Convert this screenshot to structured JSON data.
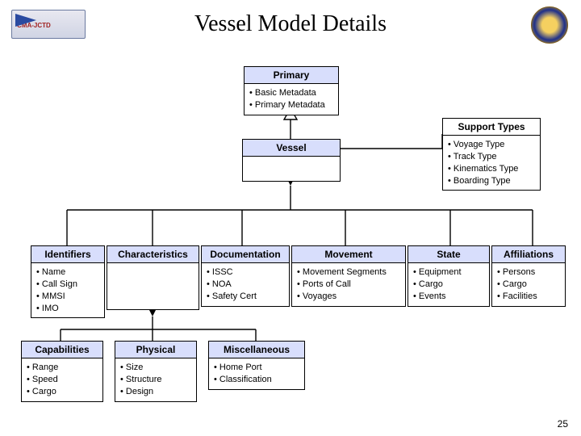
{
  "title": "Vessel Model Details",
  "page_number": "25",
  "primary": {
    "title": "Primary",
    "items": [
      "Basic Metadata",
      "Primary Metadata"
    ]
  },
  "vessel": {
    "title": "Vessel"
  },
  "support": {
    "title": "Support Types",
    "items": [
      "Voyage Type",
      "Track Type",
      "Kinematics Type",
      "Boarding Type"
    ]
  },
  "row1": [
    {
      "title": "Identifiers",
      "items": [
        "Name",
        "Call Sign",
        "MMSI",
        "IMO"
      ]
    },
    {
      "title": "Characteristics",
      "items": []
    },
    {
      "title": "Documentation",
      "items": [
        "ISSC",
        "NOA",
        "Safety Cert"
      ]
    },
    {
      "title": "Movement",
      "items": [
        "Movement Segments",
        "Ports of Call",
        "Voyages"
      ]
    },
    {
      "title": "State",
      "items": [
        "Equipment",
        "Cargo",
        "Events"
      ]
    },
    {
      "title": "Affiliations",
      "items": [
        "Persons",
        "Cargo",
        "Facilities"
      ]
    }
  ],
  "row2": [
    {
      "title": "Capabilities",
      "items": [
        "Range",
        "Speed",
        "Cargo"
      ]
    },
    {
      "title": "Physical",
      "items": [
        "Size",
        "Structure",
        "Design"
      ]
    },
    {
      "title": "Miscellaneous",
      "items": [
        "Home Port",
        "Classification"
      ]
    }
  ],
  "logo_left_text": "CMA-JCTD"
}
